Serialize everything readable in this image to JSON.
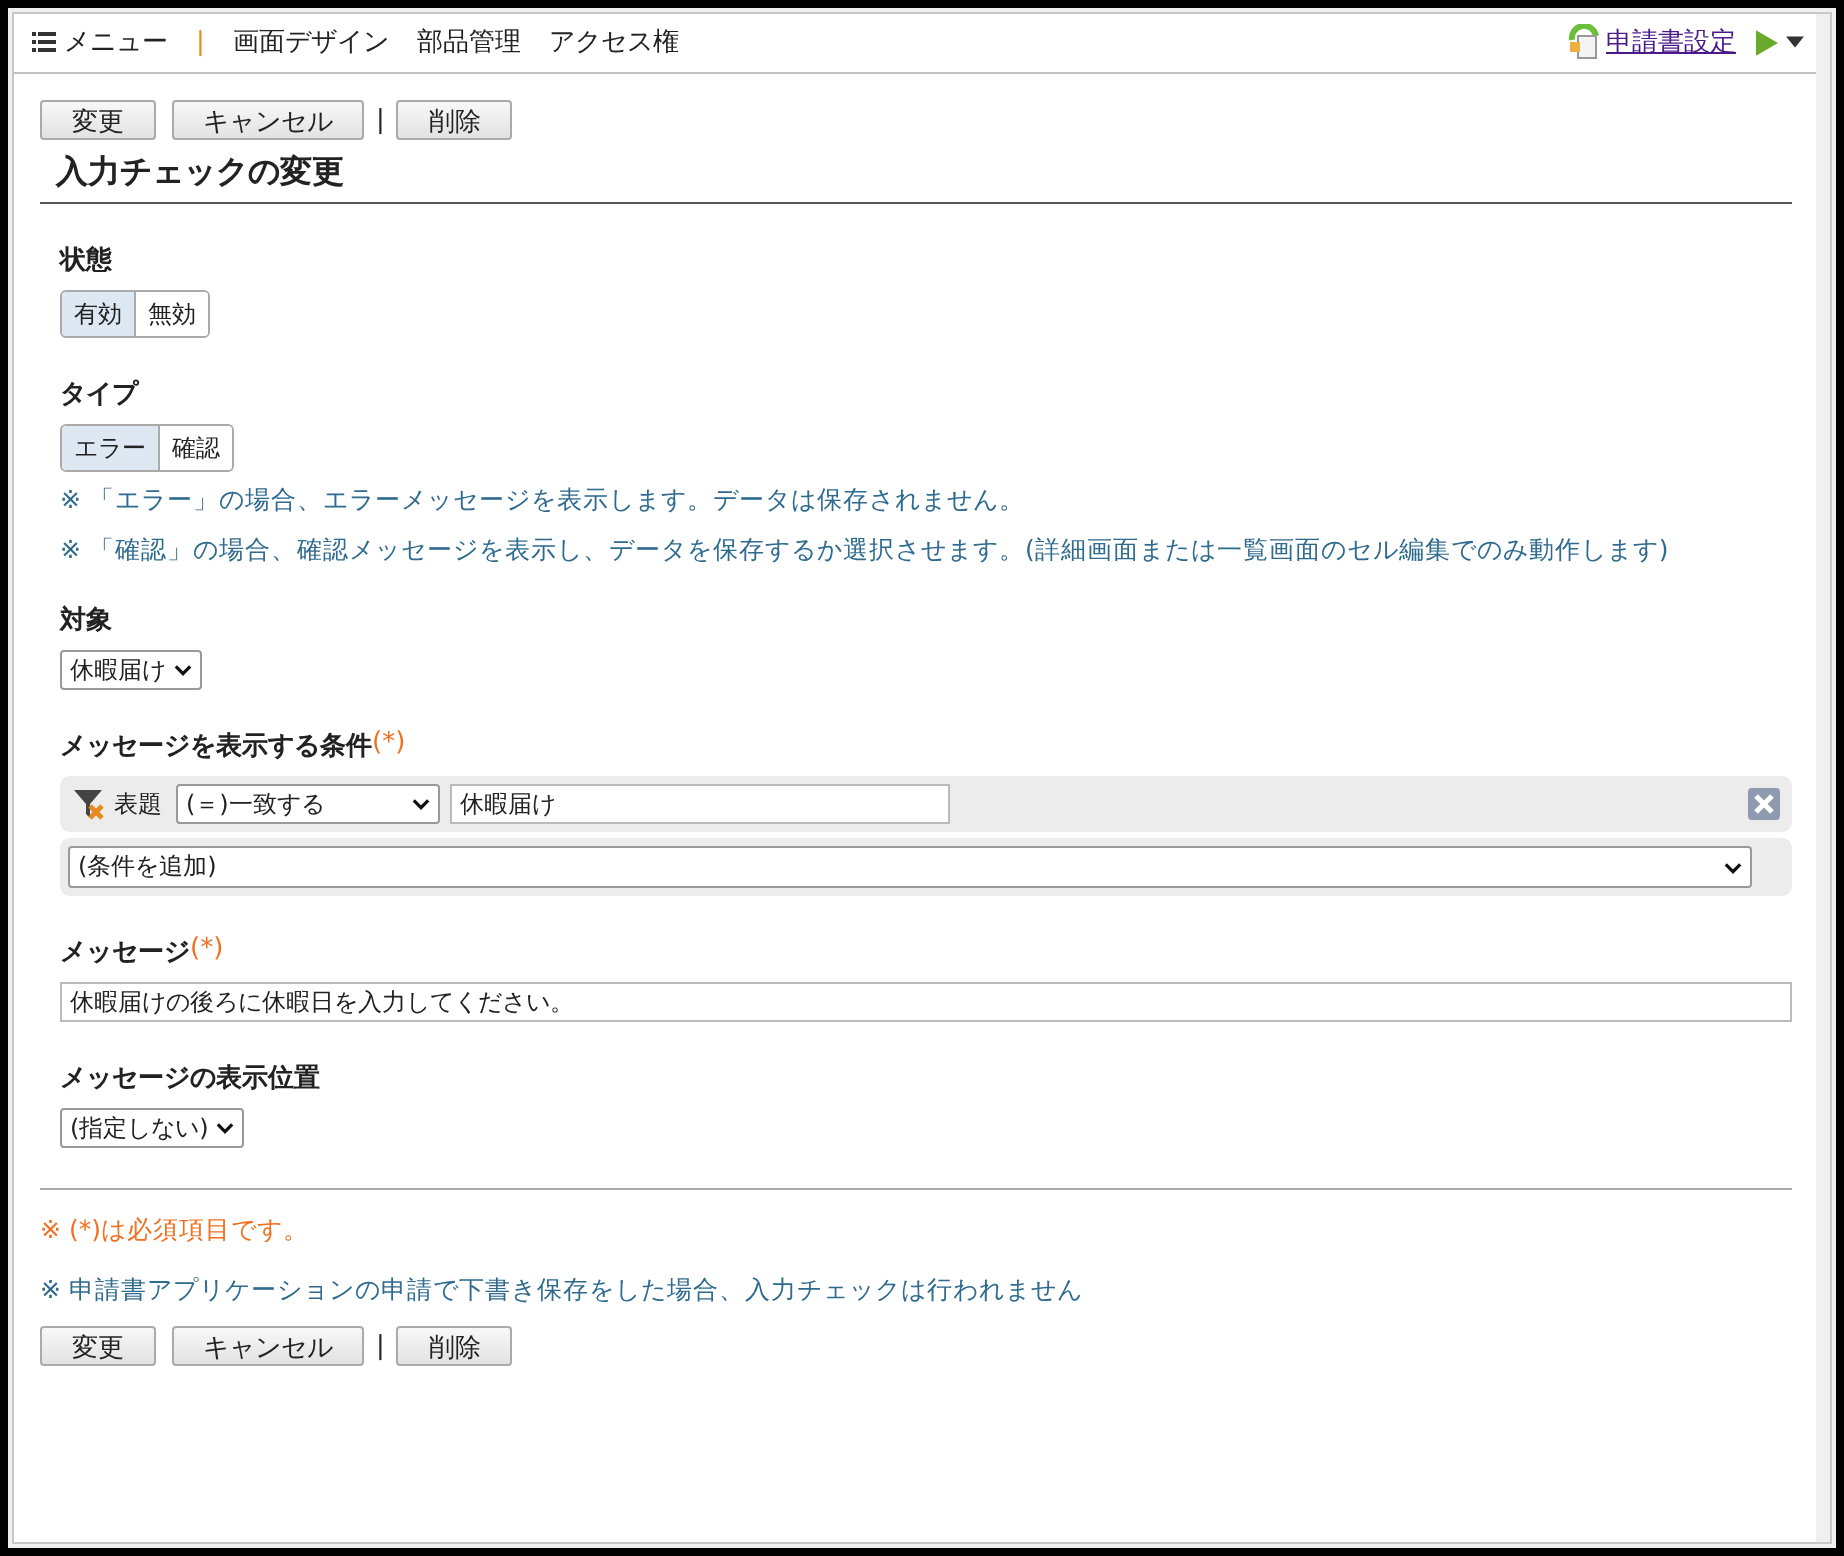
{
  "menu": {
    "label": "メニュー",
    "separator": "|",
    "items": [
      "画面デザイン",
      "部品管理",
      "アクセス権"
    ],
    "settings_link": "申請書設定"
  },
  "toolbar_top": {
    "buttons": [
      "変更",
      "キャンセル"
    ],
    "separator": "|",
    "danger_button": "削除"
  },
  "title": "入力チェックの変更",
  "fields": [
    {
      "kind": "toggle",
      "label": "状態",
      "options": [
        {
          "label": "有効",
          "selected": true
        },
        {
          "label": "無効",
          "selected": false
        }
      ]
    },
    {
      "kind": "toggle",
      "label": "タイプ",
      "options": [
        {
          "label": "エラー",
          "selected": true
        },
        {
          "label": "確認",
          "selected": false
        }
      ],
      "notes": [
        "※ 「エラー」の場合、エラーメッセージを表示します。データは保存されません。",
        "※ 「確認」の場合、確認メッセージを表示し、データを保存するか選択させます。(詳細画面または一覧画面のセル編集でのみ動作します)"
      ]
    },
    {
      "kind": "select",
      "label": "対象",
      "value": "休暇届け"
    },
    {
      "kind": "conditions",
      "label": "メッセージを表示する条件",
      "required_mark": "(*)",
      "conditions": [
        {
          "field": "表題",
          "operator": "(＝)一致する",
          "value": "休暇届け"
        }
      ],
      "add_select": "(条件を追加)"
    },
    {
      "kind": "text",
      "label": "メッセージ",
      "required_mark": "(*)",
      "value": "休暇届けの後ろに休暇日を入力してください。"
    },
    {
      "kind": "select",
      "label": "メッセージの表示位置",
      "value": "(指定しない)"
    }
  ],
  "footer_notes": [
    {
      "text": "※ (*)は必須項目です。",
      "color": "#f07020"
    },
    {
      "text": "※ 申請書アプリケーションの申請で下書き保存をした場合、入力チェックは行われません",
      "color": "#2f6b8f"
    }
  ],
  "toolbar_bottom": {
    "buttons": [
      "変更",
      "キャンセル"
    ],
    "separator": "|",
    "danger_button": "削除"
  }
}
